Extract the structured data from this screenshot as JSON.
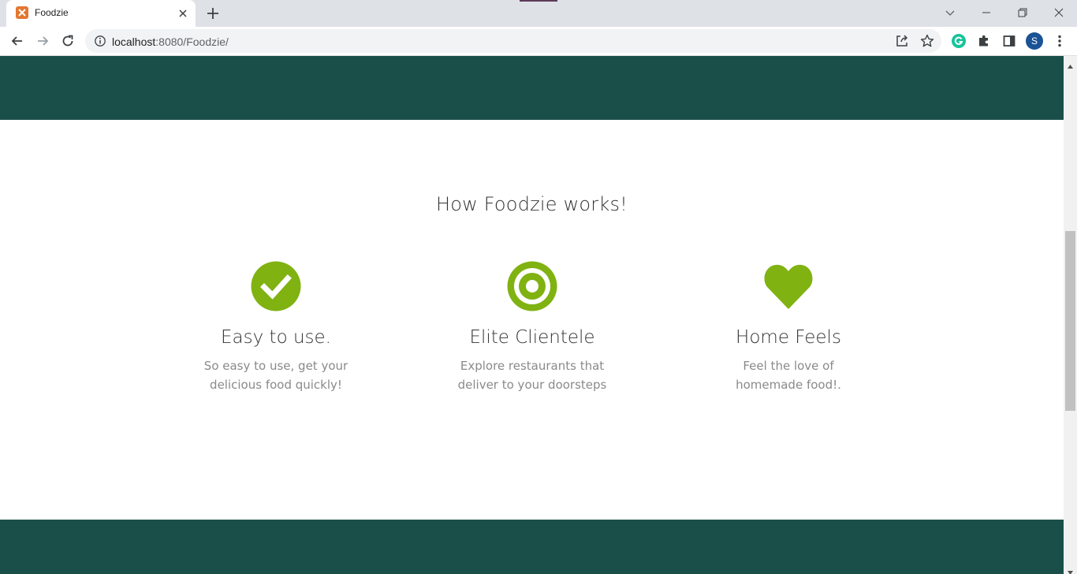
{
  "browser": {
    "tab_title": "Foodzie",
    "url_host": "localhost",
    "url_rest": ":8080/Foodzie/",
    "profile_initial": "S"
  },
  "page": {
    "section_title": "How Foodzie works!",
    "features": [
      {
        "icon": "check-circle-icon",
        "title": "Easy to use.",
        "desc": "So easy to use, get your delicious food quickly!"
      },
      {
        "icon": "bullseye-icon",
        "title": "Elite Clientele",
        "desc": "Explore restaurants that deliver to your doorsteps"
      },
      {
        "icon": "heart-icon",
        "title": "Home Feels",
        "desc": "Feel the love of homemade food!."
      }
    ]
  },
  "colors": {
    "accent_green": "#80b212",
    "band_dark_teal": "#1a4f49",
    "title_text": "#333333",
    "desc_text": "#8a8a8a"
  }
}
